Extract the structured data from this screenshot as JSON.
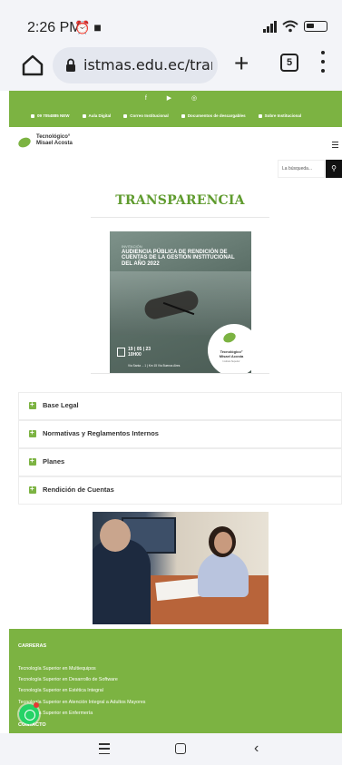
{
  "status_bar": {
    "time": "2:26 PM",
    "left_icons": [
      "alarm-icon",
      "notification-icon"
    ],
    "right_icons": [
      "signal-icon",
      "wifi-icon",
      "battery-icon"
    ]
  },
  "browser": {
    "url": "istmas.edu.ec/transpa",
    "tab_count": "5",
    "icons": [
      "home-icon",
      "lock-icon",
      "plus-icon",
      "tabs-icon",
      "more-vert-icon"
    ]
  },
  "topbar": {
    "social": "f  ▶  ◎",
    "contacts": [
      "09 7054885  NEW",
      "Aula Digital",
      "Correo Institucional",
      "Documentos de descargables",
      "Sobre Institucional"
    ]
  },
  "header": {
    "logo_line1": "Tecnológico°",
    "logo_line2": "Misael Acosta"
  },
  "search": {
    "placeholder": "La búsqueda..."
  },
  "page": {
    "title": "TRANSPARENCIA"
  },
  "banner": {
    "kicker": "INVITACIÓN",
    "headline": "AUDIENCIA PÚBLICA DE RENDICIÓN DE CUENTAS DE LA GESTIÓN INSTITUCIONAL DEL AÑO 2022",
    "date": "19 | 05 | 23",
    "time": "10H00",
    "place": "Vía Santa ... 1 | Km 15 Vía Buenos Aires",
    "logo_line1": "Tecnológico°",
    "logo_line2": "Misael Acosta",
    "logo_sub": "Instituto Superior"
  },
  "accordion": [
    {
      "label": "Base Legal"
    },
    {
      "label": "Normativas y Reglamentos Internos"
    },
    {
      "label": "Planes"
    },
    {
      "label": "Rendición de Cuentas"
    }
  ],
  "footer": {
    "heading": "CARRERAS",
    "links": [
      "Tecnología Superior en Multiequipos",
      "Tecnología Superior en Desarrollo de Software",
      "Tecnología Superior en Estética Integral",
      "Tecnología Superior en Atención Integral a Adultos Mayores",
      "Tecnología Superior en Enfermería"
    ],
    "contact_heading": "CONTACTO"
  },
  "colors": {
    "brand_green": "#7cb342",
    "title_green": "#5f9b2e"
  }
}
